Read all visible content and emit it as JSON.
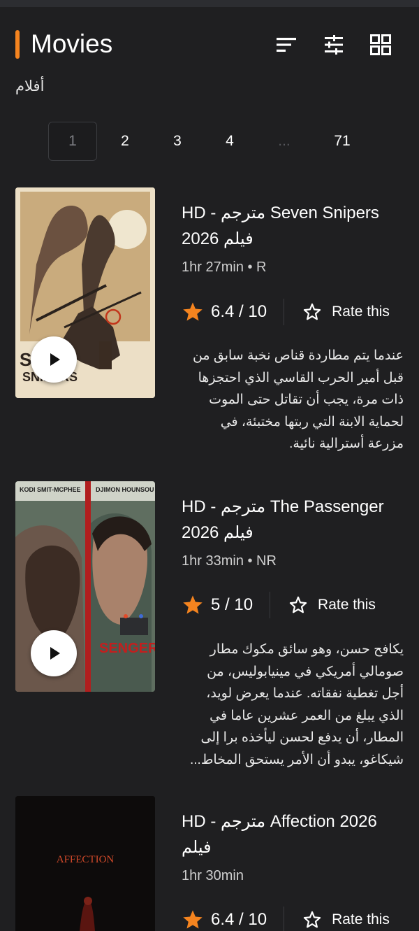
{
  "header": {
    "title": "Movies",
    "subtitle": "أفلام",
    "accent_color": "#f5841f",
    "icons": [
      "sort-icon",
      "filter-sliders-icon",
      "grid-view-icon"
    ]
  },
  "pagination": {
    "pages": [
      "1",
      "2",
      "3",
      "4",
      "...",
      "71"
    ],
    "current": "1"
  },
  "movies": [
    {
      "title": "HD - مترجم Seven Snipers فيلم 2026",
      "meta": "1hr 27min • R",
      "rating": "6.4 / 10",
      "rate_label": "Rate this",
      "description": "عندما يتم مطاردة قناص نخبة سابق من قبل أمير الحرب القاسي الذي احتجزها ذات مرة، يجب أن تقاتل حتى الموت لحماية الابنة التي ربتها مختبئة، في مزرعة أسترالية نائية."
    },
    {
      "title": "HD - مترجم The Passenger فيلم 2026",
      "meta": "1hr 33min • NR",
      "rating": "5 / 10",
      "rate_label": "Rate this",
      "poster_left_text": "KODI SMIT-MCPHEE",
      "poster_right_text": "DJIMON HOUNSOU",
      "poster_title": "THE PASSENGER",
      "description": "يكافح حسن، وهو سائق مكوك مطار صومالي أمريكي في مينيابوليس، من أجل تغطية نفقاته. عندما يعرض لويد، الذي يبلغ من العمر عشرين عاما في المطار، أن يدفع لحسن ليأخذه برا إلى شيكاغو، يبدو أن الأمر يستحق المخاط..."
    },
    {
      "title": "HD - مترجم Affection 2026 فيلم",
      "meta": "1hr 30min",
      "rating": "6.4 / 10",
      "rate_label": "Rate this",
      "poster_title": "AFFECTION"
    }
  ],
  "colors": {
    "background": "#1f1f21",
    "star_filled": "#f5841f",
    "text": "#ffffff"
  }
}
